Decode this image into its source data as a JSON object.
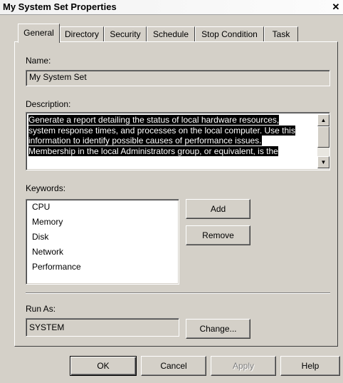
{
  "window": {
    "title": "My System Set Properties",
    "close_glyph": "✕"
  },
  "tabs": [
    {
      "label": "General",
      "active": true
    },
    {
      "label": "Directory",
      "active": false
    },
    {
      "label": "Security",
      "active": false
    },
    {
      "label": "Schedule",
      "active": false
    },
    {
      "label": "Stop Condition",
      "active": false
    },
    {
      "label": "Task",
      "active": false
    }
  ],
  "general": {
    "name_label": "Name:",
    "name_value": "My System Set",
    "description_label": "Description:",
    "description_lines": [
      "Generate a report detailing the status of local hardware resources,",
      "system response times, and processes on the local computer. Use this",
      "information to identify possible causes of performance issues.",
      "Membership in the local Administrators group, or equivalent, is the"
    ],
    "scroll_up_glyph": "▲",
    "scroll_down_glyph": "▼",
    "keywords_label": "Keywords:",
    "keywords": [
      "CPU",
      "Memory",
      "Disk",
      "Network",
      "Performance"
    ],
    "add_label": "Add",
    "remove_label": "Remove",
    "run_as_label": "Run As:",
    "run_as_value": "SYSTEM",
    "change_label": "Change..."
  },
  "footer": {
    "ok_label": "OK",
    "cancel_label": "Cancel",
    "apply_label": "Apply",
    "help_label": "Help"
  },
  "colors": {
    "dialog_bg": "#d4d0c8",
    "selection_bg": "#000000",
    "selection_fg": "#ffffff"
  }
}
